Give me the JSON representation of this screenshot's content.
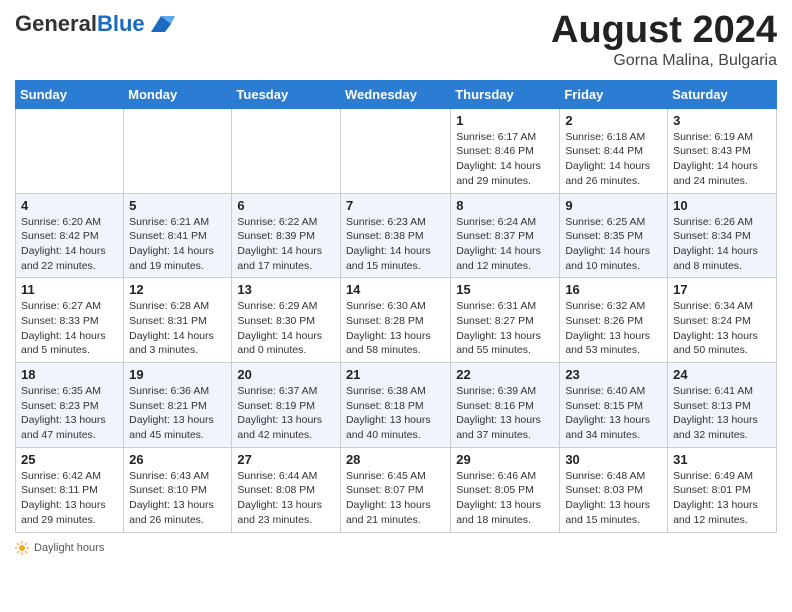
{
  "header": {
    "logo_general": "General",
    "logo_blue": "Blue",
    "month_year": "August 2024",
    "location": "Gorna Malina, Bulgaria"
  },
  "days_of_week": [
    "Sunday",
    "Monday",
    "Tuesday",
    "Wednesday",
    "Thursday",
    "Friday",
    "Saturday"
  ],
  "weeks": [
    [
      {
        "day": "",
        "info": ""
      },
      {
        "day": "",
        "info": ""
      },
      {
        "day": "",
        "info": ""
      },
      {
        "day": "",
        "info": ""
      },
      {
        "day": "1",
        "info": "Sunrise: 6:17 AM\nSunset: 8:46 PM\nDaylight: 14 hours and 29 minutes."
      },
      {
        "day": "2",
        "info": "Sunrise: 6:18 AM\nSunset: 8:44 PM\nDaylight: 14 hours and 26 minutes."
      },
      {
        "day": "3",
        "info": "Sunrise: 6:19 AM\nSunset: 8:43 PM\nDaylight: 14 hours and 24 minutes."
      }
    ],
    [
      {
        "day": "4",
        "info": "Sunrise: 6:20 AM\nSunset: 8:42 PM\nDaylight: 14 hours and 22 minutes."
      },
      {
        "day": "5",
        "info": "Sunrise: 6:21 AM\nSunset: 8:41 PM\nDaylight: 14 hours and 19 minutes."
      },
      {
        "day": "6",
        "info": "Sunrise: 6:22 AM\nSunset: 8:39 PM\nDaylight: 14 hours and 17 minutes."
      },
      {
        "day": "7",
        "info": "Sunrise: 6:23 AM\nSunset: 8:38 PM\nDaylight: 14 hours and 15 minutes."
      },
      {
        "day": "8",
        "info": "Sunrise: 6:24 AM\nSunset: 8:37 PM\nDaylight: 14 hours and 12 minutes."
      },
      {
        "day": "9",
        "info": "Sunrise: 6:25 AM\nSunset: 8:35 PM\nDaylight: 14 hours and 10 minutes."
      },
      {
        "day": "10",
        "info": "Sunrise: 6:26 AM\nSunset: 8:34 PM\nDaylight: 14 hours and 8 minutes."
      }
    ],
    [
      {
        "day": "11",
        "info": "Sunrise: 6:27 AM\nSunset: 8:33 PM\nDaylight: 14 hours and 5 minutes."
      },
      {
        "day": "12",
        "info": "Sunrise: 6:28 AM\nSunset: 8:31 PM\nDaylight: 14 hours and 3 minutes."
      },
      {
        "day": "13",
        "info": "Sunrise: 6:29 AM\nSunset: 8:30 PM\nDaylight: 14 hours and 0 minutes."
      },
      {
        "day": "14",
        "info": "Sunrise: 6:30 AM\nSunset: 8:28 PM\nDaylight: 13 hours and 58 minutes."
      },
      {
        "day": "15",
        "info": "Sunrise: 6:31 AM\nSunset: 8:27 PM\nDaylight: 13 hours and 55 minutes."
      },
      {
        "day": "16",
        "info": "Sunrise: 6:32 AM\nSunset: 8:26 PM\nDaylight: 13 hours and 53 minutes."
      },
      {
        "day": "17",
        "info": "Sunrise: 6:34 AM\nSunset: 8:24 PM\nDaylight: 13 hours and 50 minutes."
      }
    ],
    [
      {
        "day": "18",
        "info": "Sunrise: 6:35 AM\nSunset: 8:23 PM\nDaylight: 13 hours and 47 minutes."
      },
      {
        "day": "19",
        "info": "Sunrise: 6:36 AM\nSunset: 8:21 PM\nDaylight: 13 hours and 45 minutes."
      },
      {
        "day": "20",
        "info": "Sunrise: 6:37 AM\nSunset: 8:19 PM\nDaylight: 13 hours and 42 minutes."
      },
      {
        "day": "21",
        "info": "Sunrise: 6:38 AM\nSunset: 8:18 PM\nDaylight: 13 hours and 40 minutes."
      },
      {
        "day": "22",
        "info": "Sunrise: 6:39 AM\nSunset: 8:16 PM\nDaylight: 13 hours and 37 minutes."
      },
      {
        "day": "23",
        "info": "Sunrise: 6:40 AM\nSunset: 8:15 PM\nDaylight: 13 hours and 34 minutes."
      },
      {
        "day": "24",
        "info": "Sunrise: 6:41 AM\nSunset: 8:13 PM\nDaylight: 13 hours and 32 minutes."
      }
    ],
    [
      {
        "day": "25",
        "info": "Sunrise: 6:42 AM\nSunset: 8:11 PM\nDaylight: 13 hours and 29 minutes."
      },
      {
        "day": "26",
        "info": "Sunrise: 6:43 AM\nSunset: 8:10 PM\nDaylight: 13 hours and 26 minutes."
      },
      {
        "day": "27",
        "info": "Sunrise: 6:44 AM\nSunset: 8:08 PM\nDaylight: 13 hours and 23 minutes."
      },
      {
        "day": "28",
        "info": "Sunrise: 6:45 AM\nSunset: 8:07 PM\nDaylight: 13 hours and 21 minutes."
      },
      {
        "day": "29",
        "info": "Sunrise: 6:46 AM\nSunset: 8:05 PM\nDaylight: 13 hours and 18 minutes."
      },
      {
        "day": "30",
        "info": "Sunrise: 6:48 AM\nSunset: 8:03 PM\nDaylight: 13 hours and 15 minutes."
      },
      {
        "day": "31",
        "info": "Sunrise: 6:49 AM\nSunset: 8:01 PM\nDaylight: 13 hours and 12 minutes."
      }
    ]
  ],
  "footer": {
    "daylight_label": "Daylight hours"
  }
}
